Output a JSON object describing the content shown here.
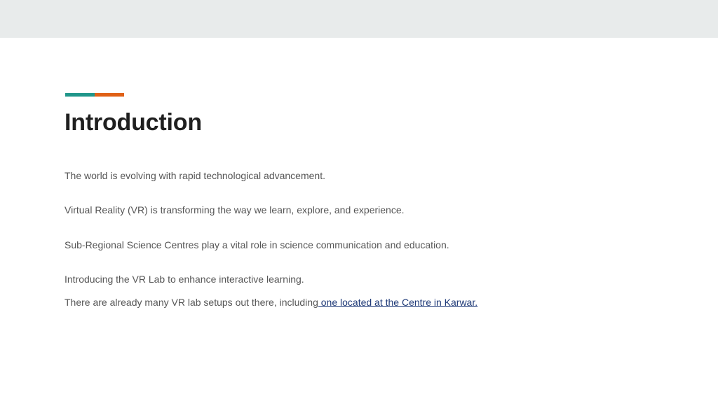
{
  "colors": {
    "top_band": "#e8ebeb",
    "accent_teal": "#20968a",
    "accent_orange": "#e06016",
    "title": "#1f1f1f",
    "body_text": "#555555",
    "link": "#1f3a78"
  },
  "slide": {
    "title": "Introduction",
    "paragraphs": [
      "The world is evolving with rapid technological advancement.",
      "Virtual Reality (VR) is transforming the way we learn, explore, and experience.",
      "Sub-Regional Science Centres play a vital role in science communication and education.",
      "Introducing the VR Lab to enhance interactive learning."
    ],
    "last_paragraph": {
      "text": "There are already many VR lab setups out there, including",
      "link_text": " one located at the Centre in Karwar."
    }
  }
}
